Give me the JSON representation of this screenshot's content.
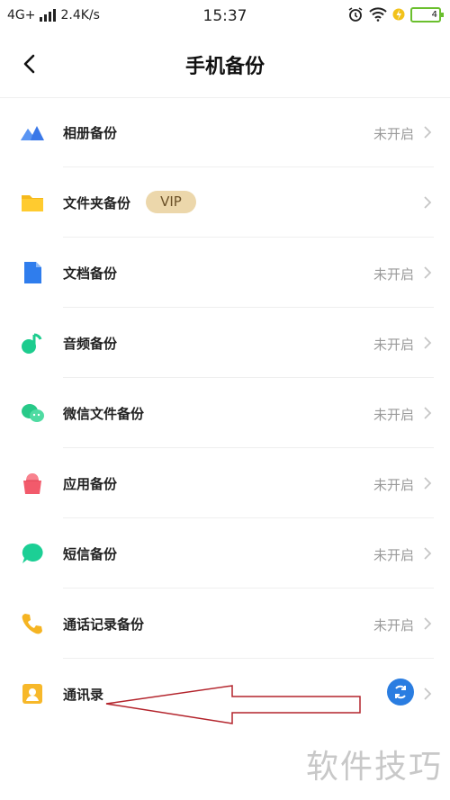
{
  "status_bar": {
    "network": "4G+",
    "speed": "2.4K/s",
    "time": "15:37",
    "battery_level": "4"
  },
  "header": {
    "title": "手机备份"
  },
  "list": [
    {
      "label": "相册备份",
      "status": "未开启",
      "icon": "photo-mountain-icon"
    },
    {
      "label": "文件夹备份",
      "badge": "VIP",
      "status": "",
      "icon": "folder-icon"
    },
    {
      "label": "文档备份",
      "status": "未开启",
      "icon": "document-icon"
    },
    {
      "label": "音频备份",
      "status": "未开启",
      "icon": "music-note-icon"
    },
    {
      "label": "微信文件备份",
      "status": "未开启",
      "icon": "wechat-icon"
    },
    {
      "label": "应用备份",
      "status": "未开启",
      "icon": "app-bag-icon"
    },
    {
      "label": "短信备份",
      "status": "未开启",
      "icon": "sms-bubble-icon"
    },
    {
      "label": "通话记录备份",
      "status": "未开启",
      "icon": "phone-icon"
    },
    {
      "label": "通讯录",
      "status": "",
      "icon": "contacts-icon",
      "action_icon": "sync-icon"
    }
  ],
  "watermark": "软件技巧",
  "colors": {
    "accent_blue": "#2a7de1",
    "vip_bg": "#ecd7ab",
    "annotation_red": "#b3232b",
    "status_gray": "#9a9a9a"
  }
}
